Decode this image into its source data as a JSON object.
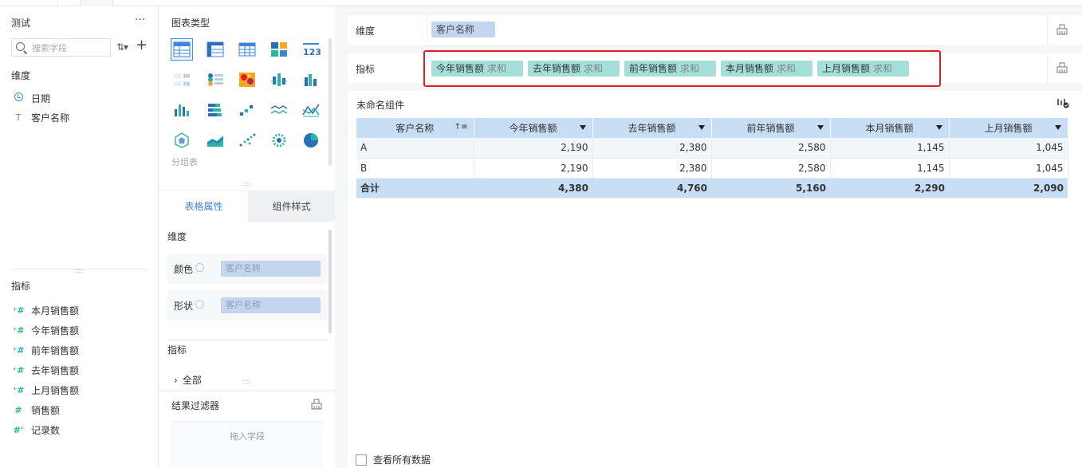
{
  "left": {
    "title": "测试",
    "more": "···",
    "search_placeholder": "搜索字段",
    "dim_section": "维度",
    "dimensions": [
      {
        "icon": "clock-icon",
        "label": "日期"
      },
      {
        "icon": "text-type-icon",
        "label": "客户名称"
      }
    ],
    "metric_section": "指标",
    "metrics": [
      {
        "icon": "calc-hash-icon",
        "label": "本月销售额"
      },
      {
        "icon": "calc-hash-icon",
        "label": "今年销售额"
      },
      {
        "icon": "calc-hash-icon",
        "label": "前年销售额"
      },
      {
        "icon": "calc-hash-icon",
        "label": "去年销售额"
      },
      {
        "icon": "calc-hash-icon",
        "label": "上月销售额"
      },
      {
        "icon": "hash-icon",
        "label": "销售额"
      },
      {
        "icon": "count-hash-icon",
        "label": "记录数"
      }
    ]
  },
  "middle": {
    "chart_type_title": "图表类型",
    "selected_chart_label": "分组表",
    "tabs": [
      "表格属性",
      "组件样式"
    ],
    "dim_section": "维度",
    "color_label": "颜色",
    "color_field": "客户名称",
    "shape_label": "形状",
    "shape_field": "客户名称",
    "metric_section": "指标",
    "expand_all": "全部",
    "filter_title": "结果过滤器",
    "filter_drop": "拖入字段"
  },
  "shelves": {
    "dim_label": "维度",
    "dim_pill": "客户名称",
    "metric_label": "指标",
    "metric_pills": [
      {
        "name": "今年销售额",
        "agg": "求和"
      },
      {
        "name": "去年销售额",
        "agg": "求和"
      },
      {
        "name": "前年销售额",
        "agg": "求和"
      },
      {
        "name": "本月销售额",
        "agg": "求和"
      },
      {
        "name": "上月销售额",
        "agg": "求和"
      }
    ]
  },
  "widget": {
    "title": "未命名组件",
    "headers": [
      "客户名称",
      "今年销售额",
      "去年销售额",
      "前年销售额",
      "本月销售额",
      "上月销售额"
    ],
    "rows": [
      [
        "A",
        "2,190",
        "2,380",
        "2,580",
        "1,145",
        "1,045"
      ],
      [
        "B",
        "2,190",
        "2,380",
        "2,580",
        "1,145",
        "1,045"
      ]
    ],
    "total": [
      "合计",
      "4,380",
      "4,760",
      "5,160",
      "2,290",
      "2,090"
    ],
    "view_all": "查看所有数据"
  },
  "colors": {
    "accent": "#3c86d9",
    "dim_pill": "#c4d6ef",
    "metric_pill": "#a6ded8",
    "table_header": "#c8def5",
    "highlight": "#e02020"
  }
}
